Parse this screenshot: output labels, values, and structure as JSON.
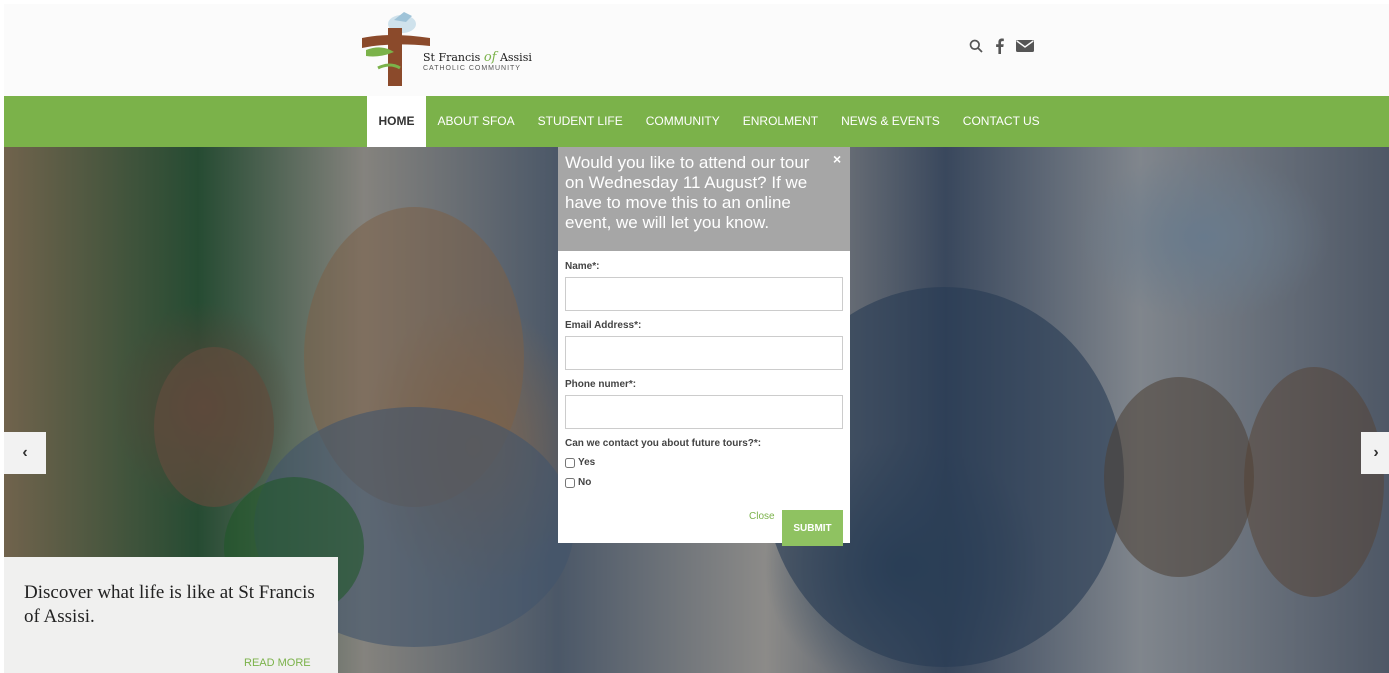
{
  "header": {
    "logo": {
      "name_part1": "St Francis",
      "name_of": "of",
      "name_part2": "Assisi",
      "subtitle": "CATHOLIC COMMUNITY"
    },
    "icons": [
      "search-icon",
      "facebook-icon",
      "envelope-icon"
    ]
  },
  "nav": {
    "items": [
      {
        "label": "HOME",
        "active": true
      },
      {
        "label": "ABOUT SFOA",
        "active": false
      },
      {
        "label": "STUDENT LIFE",
        "active": false
      },
      {
        "label": "COMMUNITY",
        "active": false
      },
      {
        "label": "ENROLMENT",
        "active": false
      },
      {
        "label": "NEWS & EVENTS",
        "active": false
      },
      {
        "label": "CONTACT US",
        "active": false
      }
    ]
  },
  "hero": {
    "caption_text": "Discover what life is like at St Francis of Assisi.",
    "read_more": "READ MORE",
    "prev_glyph": "‹",
    "next_glyph": "›"
  },
  "modal": {
    "title": "Would you like to attend our tour on Wednesday 11 August? If we have to move this to an online event, we will let you know.",
    "close_glyph": "×",
    "fields": {
      "name_label": "Name*:",
      "name_value": "",
      "email_label": "Email Address*:",
      "email_value": "",
      "phone_label": "Phone numer*:",
      "phone_value": ""
    },
    "contact_question": "Can we contact you about future tours?*:",
    "options": {
      "yes": "Yes",
      "no": "No"
    },
    "close_label": "Close",
    "submit_label": "SUBMIT"
  },
  "colors": {
    "brand_green": "#7bb24a",
    "submit_green": "#8fc261",
    "modal_header": "#a6a6a6"
  }
}
